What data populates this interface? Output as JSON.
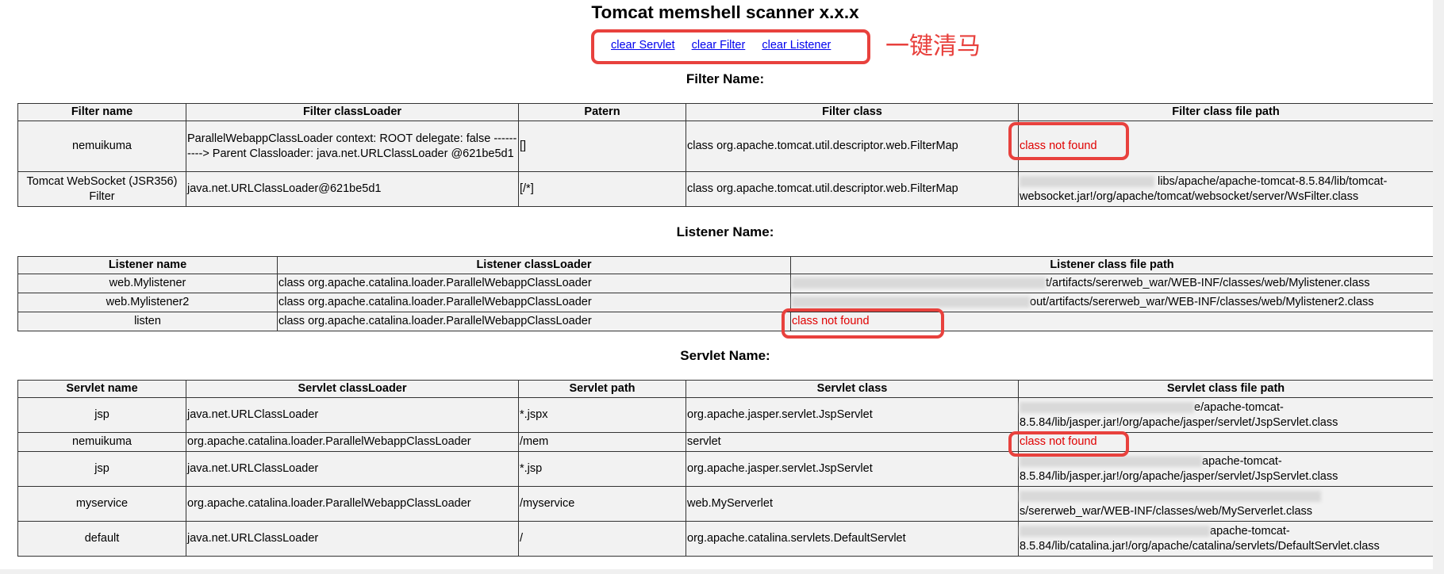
{
  "title": "Tomcat memshell scanner x.x.x",
  "links": [
    "clear Servlet",
    "clear Filter",
    "clear Listener"
  ],
  "annotation": "一键清马",
  "filter": {
    "section_title": "Filter Name:",
    "headers": [
      "Filter name",
      "Filter classLoader",
      "Patern",
      "Filter class",
      "Filter class file path"
    ],
    "rows": [
      [
        "nemuikuma",
        "ParallelWebappClassLoader context: ROOT delegate: false ----------> Parent Classloader: java.net.URLClassLoader @621be5d1",
        "[]",
        "class org.apache.tomcat.util.descriptor.web.FilterMap",
        "class not found"
      ],
      [
        "Tomcat WebSocket (JSR356) Filter",
        "java.net.URLClassLoader@621be5d1",
        "[/*]",
        "class org.apache.tomcat.util.descriptor.web.FilterMap",
        "libs/apache/apache-tomcat-8.5.84/lib/tomcat-websocket.jar!/org/apache/tomcat/websocket/server/WsFilter.class"
      ]
    ]
  },
  "listener": {
    "section_title": "Listener Name:",
    "headers": [
      "Listener name",
      "Listener classLoader",
      "Listener class file path"
    ],
    "rows": [
      [
        "web.Mylistener",
        "class org.apache.catalina.loader.ParallelWebappClassLoader",
        "t/artifacts/sererweb_war/WEB-INF/classes/web/Mylistener.class"
      ],
      [
        "web.Mylistener2",
        "class org.apache.catalina.loader.ParallelWebappClassLoader",
        "out/artifacts/sererweb_war/WEB-INF/classes/web/Mylistener2.class"
      ],
      [
        "listen",
        "class org.apache.catalina.loader.ParallelWebappClassLoader",
        "class not found"
      ]
    ]
  },
  "servlet": {
    "section_title": "Servlet Name:",
    "headers": [
      "Servlet name",
      "Servlet classLoader",
      "Servlet path",
      "Servlet class",
      "Servlet class file path"
    ],
    "rows": [
      [
        "jsp",
        "java.net.URLClassLoader",
        "*.jspx",
        "org.apache.jasper.servlet.JspServlet",
        "e/apache-tomcat-8.5.84/lib/jasper.jar!/org/apache/jasper/servlet/JspServlet.class"
      ],
      [
        "nemuikuma",
        "org.apache.catalina.loader.ParallelWebappClassLoader",
        "/mem",
        "servlet",
        "class not found"
      ],
      [
        "jsp",
        "java.net.URLClassLoader",
        "*.jsp",
        "org.apache.jasper.servlet.JspServlet",
        "apache-tomcat-8.5.84/lib/jasper.jar!/org/apache/jasper/servlet/JspServlet.class"
      ],
      [
        "myservice",
        "org.apache.catalina.loader.ParallelWebappClassLoader",
        "/myservice",
        "web.MyServerlet",
        "s/sererweb_war/WEB-INF/classes/web/MyServerlet.class"
      ],
      [
        "default",
        "java.net.URLClassLoader",
        "/",
        "org.apache.catalina.servlets.DefaultServlet",
        "apache-tomcat-8.5.84/lib/catalina.jar!/org/apache/catalina/servlets/DefaultServlet.class"
      ]
    ]
  },
  "colors": {
    "annotation": "#e8413d",
    "not_found": "#e00000",
    "link": "#0000ee",
    "table_bg": "#f2f2f2"
  }
}
